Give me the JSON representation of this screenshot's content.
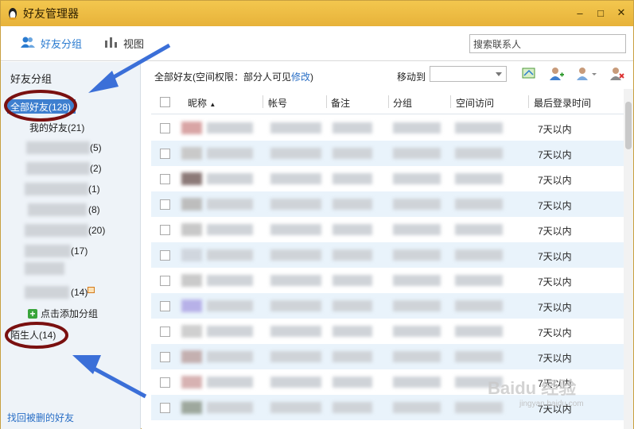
{
  "window": {
    "title": "好友管理器"
  },
  "toolbar": {
    "friends_tab": "好友分组",
    "view_tab": "视图",
    "search_placeholder": "搜索联系人"
  },
  "sidebar": {
    "heading": "好友分组",
    "all_friends": "全部好友(128)",
    "my_friends": "我的好友(21)",
    "groups": [
      {
        "count": "(5)"
      },
      {
        "count": "(2)"
      },
      {
        "count": "(1)"
      },
      {
        "count": "(8)"
      },
      {
        "count": "(20)"
      },
      {
        "count": "(17)"
      },
      {
        "count": "(14)"
      }
    ],
    "add_group": "点击添加分组",
    "strangers": "陌生人(14)",
    "recover": "找回被删的好友"
  },
  "main": {
    "filter_prefix": "全部好友(空间权限：部分人可见",
    "filter_link": "修改",
    "filter_suffix": ")",
    "move_to": "移动到",
    "columns": [
      "昵称",
      "帐号",
      "备注",
      "分组",
      "空间访问",
      "最后登录时间"
    ],
    "rows": [
      {
        "last_login": "7天以内"
      },
      {
        "last_login": "7天以内"
      },
      {
        "last_login": "7天以内"
      },
      {
        "last_login": "7天以内"
      },
      {
        "last_login": "7天以内"
      },
      {
        "last_login": "7天以内"
      },
      {
        "last_login": "7天以内"
      },
      {
        "last_login": "7天以内"
      },
      {
        "last_login": "7天以内"
      },
      {
        "last_login": "7天以内"
      },
      {
        "last_login": "7天以内"
      },
      {
        "last_login": "7天以内"
      }
    ]
  },
  "watermark": {
    "brand": "Baidu 经验",
    "url": "jingyan.baidu.com"
  },
  "colors": {
    "accent": "#3e7fcf",
    "titlebar": "#efbf45",
    "annotation_arrow": "#3b6fd8",
    "annotation_circle": "#7a1010"
  }
}
